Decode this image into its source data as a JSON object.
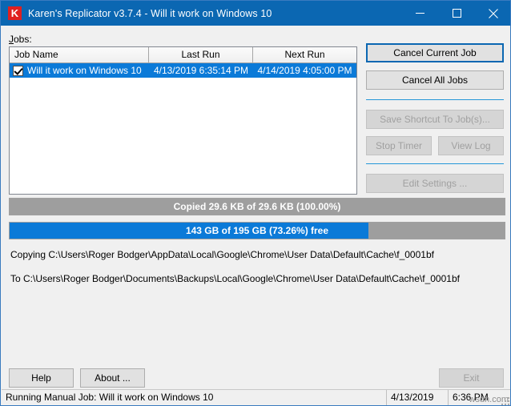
{
  "window": {
    "title": "Karen's Replicator v3.7.4 - Will it work on Windows 10",
    "icon_letter": "K",
    "icon_name": "app-icon-k",
    "controls": {
      "minimize": "minimize-icon",
      "maximize": "maximize-icon",
      "close": "close-icon"
    },
    "accent_color": "#0b67b2"
  },
  "jobs": {
    "label_accel": "J",
    "label_rest": "obs:",
    "columns": [
      "Job Name",
      "Last Run",
      "Next Run"
    ],
    "rows": [
      {
        "checked": true,
        "name": "Will it work on Windows 10",
        "last_run": "4/13/2019 6:35:14 PM",
        "next_run": "4/14/2019 4:05:00 PM",
        "selected": true
      }
    ]
  },
  "actions": {
    "cancel_current_job": "Cancel Current Job",
    "cancel_all_jobs": "Cancel All Jobs",
    "save_shortcut": "Save Shortcut To Job(s)...",
    "stop_timer": "Stop Timer",
    "view_log": "View Log",
    "edit_settings": "Edit Settings ..."
  },
  "progress": {
    "copy": {
      "text": "Copied 29.6 KB of 29.6 KB (100.00%)",
      "percent": 100,
      "fill_color": "#9e9e9e"
    },
    "disk": {
      "text": "143 GB of 195 GB (73.26%) free",
      "percent": 72.5,
      "fill_color": "#0b7ad8"
    }
  },
  "log": {
    "line1": "Copying C:\\Users\\Roger Bodger\\AppData\\Local\\Google\\Chrome\\User Data\\Default\\Cache\\f_0001bf",
    "line2": "To C:\\Users\\Roger Bodger\\Documents\\Backups\\Local\\Google\\Chrome\\User Data\\Default\\Cache\\f_0001bf"
  },
  "footer": {
    "help": "Help",
    "about": "About ...",
    "exit": "Exit"
  },
  "statusbar": {
    "message": "Running Manual Job: Will it work on Windows 10",
    "date": "4/13/2019",
    "time": "6:36 PM",
    "watermark": "wsdn.com"
  }
}
